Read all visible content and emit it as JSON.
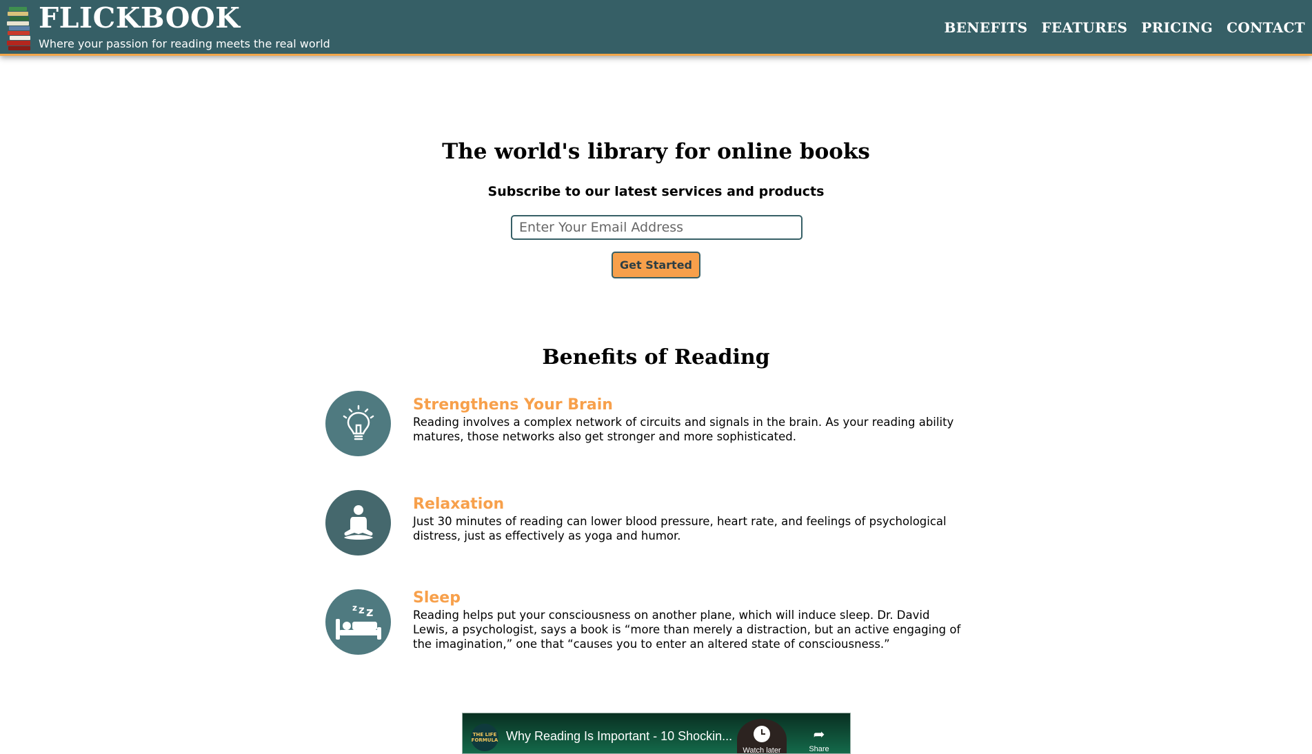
{
  "header": {
    "brand": "FLICKBOOK",
    "tagline": "Where your passion for reading meets the real world",
    "nav": [
      "BENEFITS",
      "FEATURES",
      "PRICING",
      "CONTACT"
    ]
  },
  "hero": {
    "title": "The world's library for online books",
    "subtitle": "Subscribe to our latest services and products",
    "email_placeholder": "Enter Your Email Address",
    "button_label": "Get Started"
  },
  "benefits": {
    "title": "Benefits of Reading",
    "items": [
      {
        "icon": "lightbulb-icon",
        "heading": "Strengthens Your Brain",
        "text": "Reading involves a complex network of circuits and signals in the brain. As your reading ability matures, those networks also get stronger and more sophisticated."
      },
      {
        "icon": "meditation-icon",
        "heading": "Relaxation",
        "text": "Just 30 minutes of reading can lower blood pressure, heart rate, and feelings of psychological distress, just as effectively as yoga and humor."
      },
      {
        "icon": "sleep-icon",
        "heading": "Sleep",
        "text": "Reading helps put your consciousness on another plane, which will induce sleep. Dr. David Lewis, a psychologist, says a book is “more than merely a distraction, but an active engaging of the imagination,” one that “causes you to enter an altered state of consciousness.”"
      }
    ]
  },
  "video": {
    "title": "Why Reading Is Important - 10 Shockin...",
    "channel_badge": "THE LIFE FORMULA",
    "watch_later_label": "Watch later",
    "share_label": "Share"
  },
  "colors": {
    "header_bg": "#365f66",
    "accent": "#f7a04b",
    "icon_circle": "#4f7a80"
  }
}
